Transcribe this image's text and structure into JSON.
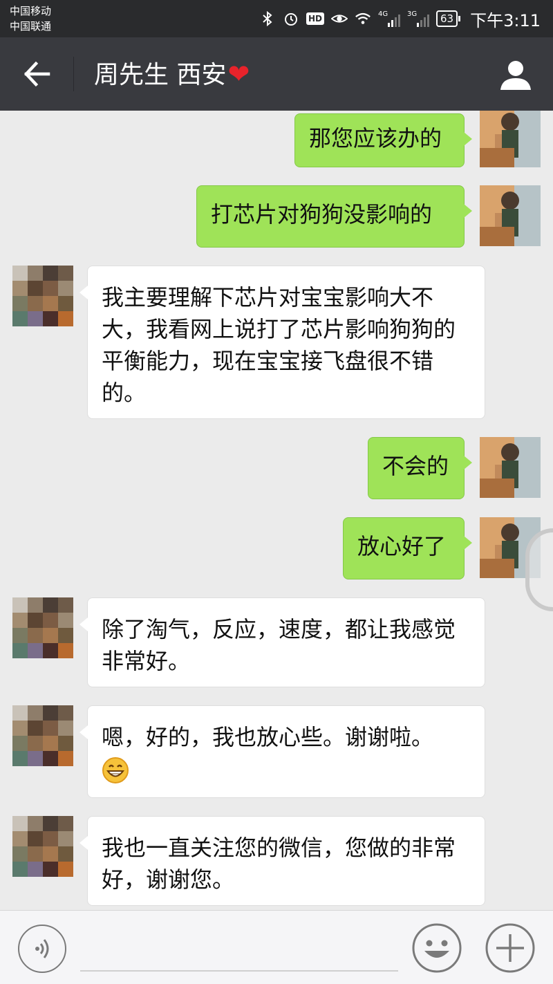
{
  "status_bar": {
    "carriers": [
      "中国移动",
      "中国联通"
    ],
    "network_badges": [
      "HD",
      "4G",
      "3G"
    ],
    "battery": "63",
    "time": "下午3:11"
  },
  "header": {
    "back_icon": "arrow-left-icon",
    "contact_name": "周先生 西安",
    "heart": "❤",
    "profile_icon": "person-icon"
  },
  "messages": [
    {
      "sender": "me",
      "text": "那您应该办的"
    },
    {
      "sender": "me",
      "text": "打芯片对狗狗没影响的"
    },
    {
      "sender": "other",
      "text": "我主要理解下芯片对宝宝影响大不大，我看网上说打了芯片影响狗狗的平衡能力，现在宝宝接飞盘很不错的。"
    },
    {
      "sender": "me",
      "text": "不会的"
    },
    {
      "sender": "me",
      "text": "放心好了"
    },
    {
      "sender": "other",
      "text": "除了淘气，反应，速度，都让我感觉非常好。"
    },
    {
      "sender": "other",
      "text": "嗯，好的，我也放心些。谢谢啦。",
      "emoji": "grinning-face-icon"
    },
    {
      "sender": "other",
      "text": "我也一直关注您的微信，您做的非常好，谢谢您。"
    }
  ],
  "input_bar": {
    "voice_icon": "voice-icon",
    "emoji_icon": "smiley-icon",
    "plus_icon": "plus-icon"
  },
  "colors": {
    "my_bubble": "#9fe358",
    "their_bubble": "#ffffff",
    "header_bg": "#393a3f",
    "chat_bg": "#ebebeb"
  }
}
